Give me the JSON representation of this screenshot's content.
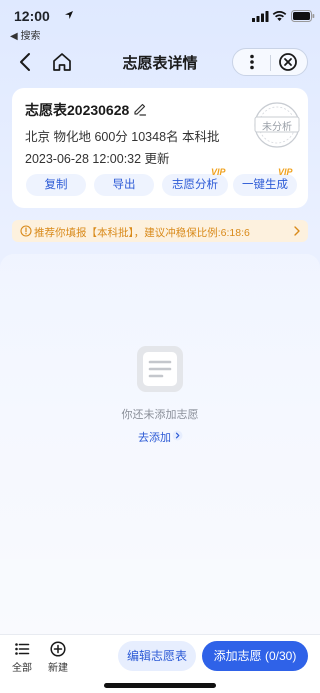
{
  "status_bar": {
    "time": "12:00",
    "back_app": "◀ 搜索"
  },
  "nav": {
    "title": "志愿表详情"
  },
  "card": {
    "title": "志愿表20230628",
    "info_line": "北京  物化地  600分  10348名  本科批",
    "updated_line": "2023-06-28 12:00:32 更新",
    "stamp": "未分析",
    "buttons": [
      "复制",
      "导出",
      "志愿分析",
      "一键生成"
    ],
    "vip_badge": "VIP"
  },
  "notice": {
    "text": "推荐你填报【本科批】，建议冲稳保比例:6:18:6"
  },
  "empty_state": {
    "message": "你还未添加志愿",
    "link": "去添加"
  },
  "bottom": {
    "tabs": [
      "全部",
      "新建"
    ],
    "edit_button": "编辑志愿表",
    "add_button": "添加志愿 (0/30)"
  },
  "colors": {
    "accent": "#2f62e8",
    "link": "#2d5bd6",
    "vip": "#f0a21f",
    "notice_text": "#d98a1a",
    "notice_bg": "#fdf1de"
  }
}
